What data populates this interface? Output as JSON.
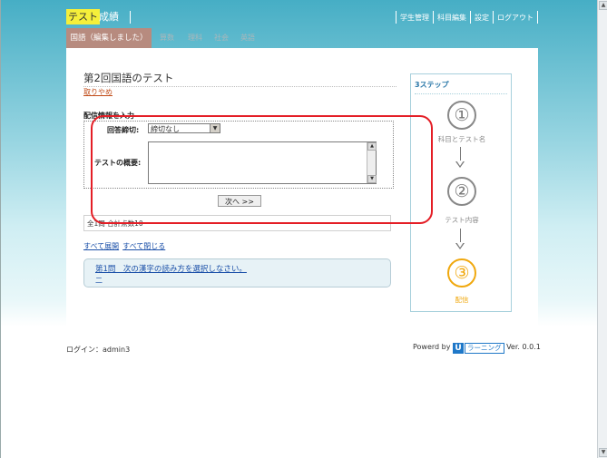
{
  "topnav": {
    "tab_test": "テスト",
    "tab_grades": "成績",
    "links": [
      "学生管理",
      "科目編集",
      "設定",
      "ログアウト"
    ]
  },
  "subjects": {
    "active": "国語（編集しました）",
    "others": [
      "算数",
      "理科",
      "社会",
      "英語"
    ]
  },
  "main": {
    "title": "第2回国語のテスト",
    "cancel_label": "取りやめ",
    "section_heading": "配信情報を入力",
    "deadline_label": "回答締切:",
    "deadline_value": "締切なし",
    "summary_label": "テストの概要:",
    "summary_value": "",
    "next_button": "次へ >>",
    "count_text": "全1問 合計点数10",
    "expand_all": "すべて展開",
    "collapse_all": "すべて閉じる",
    "question_title": "第1問　次の漢字の読み方を選択しなさい。",
    "question_sub": "二"
  },
  "steps": {
    "title": "3ステップ",
    "items": [
      {
        "number": "①",
        "label": "科目とテスト名"
      },
      {
        "number": "②",
        "label": "テスト内容"
      },
      {
        "number": "③",
        "label": "配信"
      }
    ]
  },
  "footer": {
    "login": "ログイン：admin3",
    "powered_by": "Powerd by",
    "logo_u": "U",
    "logo_text": "ラーニング",
    "version": "Ver. 0.0.1"
  },
  "colors": {
    "accent_yellow": "#f5ef3a",
    "subject_active": "#b78b7f",
    "step_active": "#f0a80e",
    "link_blue": "#1a4fa8",
    "annotation_red": "#e41e26"
  }
}
